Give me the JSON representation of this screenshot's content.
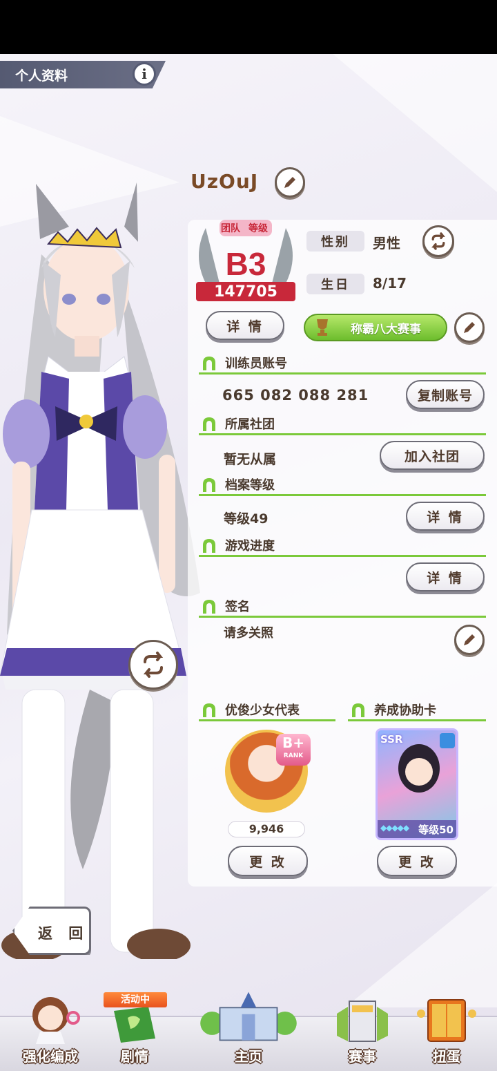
{
  "header": {
    "title": "个人资料",
    "info_icon": "i"
  },
  "profile": {
    "name": "UzOuJ",
    "rank": {
      "team_label": "团队",
      "level_label": "等级",
      "grade": "B3",
      "score": "147705"
    },
    "gender_label": "性别",
    "gender_value": "男性",
    "birthday_label": "生日",
    "birthday_value": "8/17",
    "detail_button": "详 情",
    "title_badge": "称霸八大赛事"
  },
  "sections": {
    "trainer_account": {
      "title": "训练员账号",
      "value": "665 082 088 281",
      "button": "复制账号"
    },
    "club": {
      "title": "所属社团",
      "value": "暂无从属",
      "button": "加入社团"
    },
    "archive_level": {
      "title": "档案等级",
      "value": "等级49",
      "button": "详 情"
    },
    "game_progress": {
      "title": "游戏进度",
      "button": "详 情"
    },
    "signature": {
      "title": "签名",
      "value": "请多关照"
    }
  },
  "representative": {
    "title": "优俊少女代表",
    "rank": "B+",
    "rank_sub": "RANK",
    "score": "9,946",
    "button": "更 改"
  },
  "support_card": {
    "title": "养成协助卡",
    "rarity": "SSR",
    "level": "等级50",
    "button": "更 改"
  },
  "back_button": "返 回",
  "bottom_nav": [
    {
      "label": "强化编成",
      "icon": "chibi-horse-girl-icon"
    },
    {
      "label": "剧情",
      "icon": "story-book-icon",
      "badge": "活动中"
    },
    {
      "label": "主页",
      "icon": "school-building-icon"
    },
    {
      "label": "赛事",
      "icon": "race-gate-icon"
    },
    {
      "label": "扭蛋",
      "icon": "gacha-door-icon"
    }
  ],
  "colors": {
    "accent_green": "#7bc93a",
    "brown_text": "#4a3a2e",
    "name_brown": "#7a4a26",
    "rank_red": "#c8283a"
  }
}
